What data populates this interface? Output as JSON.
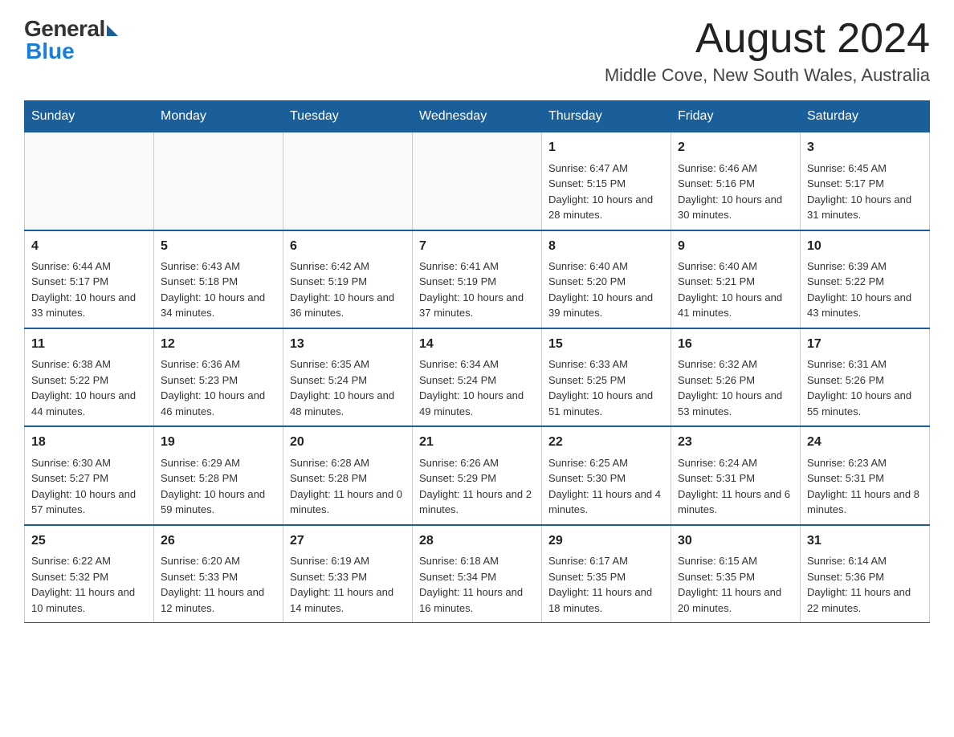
{
  "header": {
    "logo_general": "General",
    "logo_blue": "Blue",
    "month_title": "August 2024",
    "location": "Middle Cove, New South Wales, Australia"
  },
  "calendar": {
    "days_of_week": [
      "Sunday",
      "Monday",
      "Tuesday",
      "Wednesday",
      "Thursday",
      "Friday",
      "Saturday"
    ],
    "weeks": [
      [
        {
          "day": "",
          "info": ""
        },
        {
          "day": "",
          "info": ""
        },
        {
          "day": "",
          "info": ""
        },
        {
          "day": "",
          "info": ""
        },
        {
          "day": "1",
          "info": "Sunrise: 6:47 AM\nSunset: 5:15 PM\nDaylight: 10 hours and 28 minutes."
        },
        {
          "day": "2",
          "info": "Sunrise: 6:46 AM\nSunset: 5:16 PM\nDaylight: 10 hours and 30 minutes."
        },
        {
          "day": "3",
          "info": "Sunrise: 6:45 AM\nSunset: 5:17 PM\nDaylight: 10 hours and 31 minutes."
        }
      ],
      [
        {
          "day": "4",
          "info": "Sunrise: 6:44 AM\nSunset: 5:17 PM\nDaylight: 10 hours and 33 minutes."
        },
        {
          "day": "5",
          "info": "Sunrise: 6:43 AM\nSunset: 5:18 PM\nDaylight: 10 hours and 34 minutes."
        },
        {
          "day": "6",
          "info": "Sunrise: 6:42 AM\nSunset: 5:19 PM\nDaylight: 10 hours and 36 minutes."
        },
        {
          "day": "7",
          "info": "Sunrise: 6:41 AM\nSunset: 5:19 PM\nDaylight: 10 hours and 37 minutes."
        },
        {
          "day": "8",
          "info": "Sunrise: 6:40 AM\nSunset: 5:20 PM\nDaylight: 10 hours and 39 minutes."
        },
        {
          "day": "9",
          "info": "Sunrise: 6:40 AM\nSunset: 5:21 PM\nDaylight: 10 hours and 41 minutes."
        },
        {
          "day": "10",
          "info": "Sunrise: 6:39 AM\nSunset: 5:22 PM\nDaylight: 10 hours and 43 minutes."
        }
      ],
      [
        {
          "day": "11",
          "info": "Sunrise: 6:38 AM\nSunset: 5:22 PM\nDaylight: 10 hours and 44 minutes."
        },
        {
          "day": "12",
          "info": "Sunrise: 6:36 AM\nSunset: 5:23 PM\nDaylight: 10 hours and 46 minutes."
        },
        {
          "day": "13",
          "info": "Sunrise: 6:35 AM\nSunset: 5:24 PM\nDaylight: 10 hours and 48 minutes."
        },
        {
          "day": "14",
          "info": "Sunrise: 6:34 AM\nSunset: 5:24 PM\nDaylight: 10 hours and 49 minutes."
        },
        {
          "day": "15",
          "info": "Sunrise: 6:33 AM\nSunset: 5:25 PM\nDaylight: 10 hours and 51 minutes."
        },
        {
          "day": "16",
          "info": "Sunrise: 6:32 AM\nSunset: 5:26 PM\nDaylight: 10 hours and 53 minutes."
        },
        {
          "day": "17",
          "info": "Sunrise: 6:31 AM\nSunset: 5:26 PM\nDaylight: 10 hours and 55 minutes."
        }
      ],
      [
        {
          "day": "18",
          "info": "Sunrise: 6:30 AM\nSunset: 5:27 PM\nDaylight: 10 hours and 57 minutes."
        },
        {
          "day": "19",
          "info": "Sunrise: 6:29 AM\nSunset: 5:28 PM\nDaylight: 10 hours and 59 minutes."
        },
        {
          "day": "20",
          "info": "Sunrise: 6:28 AM\nSunset: 5:28 PM\nDaylight: 11 hours and 0 minutes."
        },
        {
          "day": "21",
          "info": "Sunrise: 6:26 AM\nSunset: 5:29 PM\nDaylight: 11 hours and 2 minutes."
        },
        {
          "day": "22",
          "info": "Sunrise: 6:25 AM\nSunset: 5:30 PM\nDaylight: 11 hours and 4 minutes."
        },
        {
          "day": "23",
          "info": "Sunrise: 6:24 AM\nSunset: 5:31 PM\nDaylight: 11 hours and 6 minutes."
        },
        {
          "day": "24",
          "info": "Sunrise: 6:23 AM\nSunset: 5:31 PM\nDaylight: 11 hours and 8 minutes."
        }
      ],
      [
        {
          "day": "25",
          "info": "Sunrise: 6:22 AM\nSunset: 5:32 PM\nDaylight: 11 hours and 10 minutes."
        },
        {
          "day": "26",
          "info": "Sunrise: 6:20 AM\nSunset: 5:33 PM\nDaylight: 11 hours and 12 minutes."
        },
        {
          "day": "27",
          "info": "Sunrise: 6:19 AM\nSunset: 5:33 PM\nDaylight: 11 hours and 14 minutes."
        },
        {
          "day": "28",
          "info": "Sunrise: 6:18 AM\nSunset: 5:34 PM\nDaylight: 11 hours and 16 minutes."
        },
        {
          "day": "29",
          "info": "Sunrise: 6:17 AM\nSunset: 5:35 PM\nDaylight: 11 hours and 18 minutes."
        },
        {
          "day": "30",
          "info": "Sunrise: 6:15 AM\nSunset: 5:35 PM\nDaylight: 11 hours and 20 minutes."
        },
        {
          "day": "31",
          "info": "Sunrise: 6:14 AM\nSunset: 5:36 PM\nDaylight: 11 hours and 22 minutes."
        }
      ]
    ]
  }
}
